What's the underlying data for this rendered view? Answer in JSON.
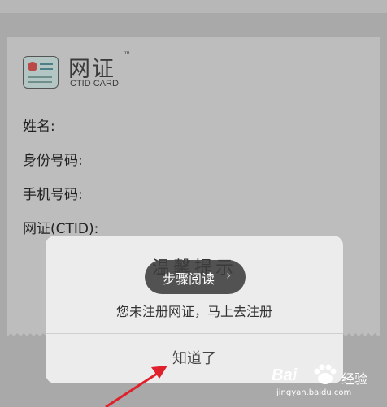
{
  "card": {
    "logo_title": "网证",
    "logo_trademark": "™",
    "logo_subtitle": "CTID CARD",
    "fields": [
      {
        "label": "姓名:"
      },
      {
        "label": "身份号码:"
      },
      {
        "label": "手机号码:"
      },
      {
        "label": "网证(CTID):"
      }
    ]
  },
  "dialog": {
    "title": "温馨提示",
    "message": "您未注册网证，马上去注册",
    "button_label": "知道了"
  },
  "toast": {
    "label": "步骤阅读",
    "chevron": "›"
  },
  "watermark": {
    "brand": "Bai",
    "suffix": "经验",
    "url": "jingyan.baidu.com"
  },
  "colors": {
    "overlay_bg": "#a9a9a9",
    "dialog_bg": "#ececec",
    "arrow": "#e0202a",
    "toast_bg": "#3c3c3c"
  }
}
